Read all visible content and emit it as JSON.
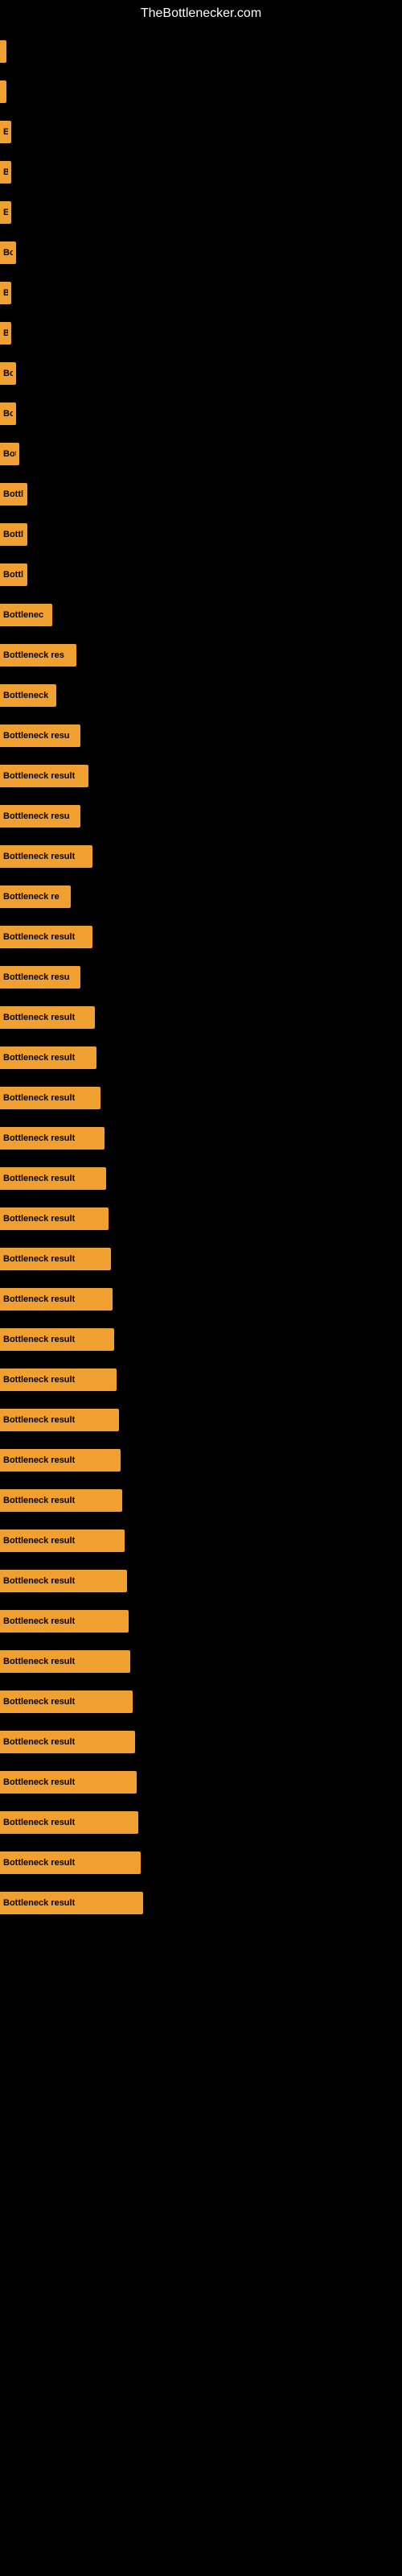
{
  "site": {
    "title": "TheBottlenecker.com"
  },
  "bars": [
    {
      "id": 1,
      "label": "",
      "width": 4
    },
    {
      "id": 2,
      "label": "",
      "width": 4
    },
    {
      "id": 3,
      "label": "E",
      "width": 14
    },
    {
      "id": 4,
      "label": "B",
      "width": 14
    },
    {
      "id": 5,
      "label": "E",
      "width": 14
    },
    {
      "id": 6,
      "label": "Bo",
      "width": 20
    },
    {
      "id": 7,
      "label": "B",
      "width": 14
    },
    {
      "id": 8,
      "label": "B",
      "width": 14
    },
    {
      "id": 9,
      "label": "Bo",
      "width": 20
    },
    {
      "id": 10,
      "label": "Bo",
      "width": 20
    },
    {
      "id": 11,
      "label": "Bot",
      "width": 24
    },
    {
      "id": 12,
      "label": "Bottl",
      "width": 34
    },
    {
      "id": 13,
      "label": "Bottl",
      "width": 34
    },
    {
      "id": 14,
      "label": "Bottl",
      "width": 34
    },
    {
      "id": 15,
      "label": "Bottlenec",
      "width": 65
    },
    {
      "id": 16,
      "label": "Bottleneck res",
      "width": 95
    },
    {
      "id": 17,
      "label": "Bottleneck",
      "width": 70
    },
    {
      "id": 18,
      "label": "Bottleneck resu",
      "width": 100
    },
    {
      "id": 19,
      "label": "Bottleneck result",
      "width": 110
    },
    {
      "id": 20,
      "label": "Bottleneck resu",
      "width": 100
    },
    {
      "id": 21,
      "label": "Bottleneck result",
      "width": 115
    },
    {
      "id": 22,
      "label": "Bottleneck re",
      "width": 88
    },
    {
      "id": 23,
      "label": "Bottleneck result",
      "width": 115
    },
    {
      "id": 24,
      "label": "Bottleneck resu",
      "width": 100
    },
    {
      "id": 25,
      "label": "Bottleneck result",
      "width": 118
    },
    {
      "id": 26,
      "label": "Bottleneck result",
      "width": 120
    },
    {
      "id": 27,
      "label": "Bottleneck result",
      "width": 125
    },
    {
      "id": 28,
      "label": "Bottleneck result",
      "width": 130
    },
    {
      "id": 29,
      "label": "Bottleneck result",
      "width": 132
    },
    {
      "id": 30,
      "label": "Bottleneck result",
      "width": 135
    },
    {
      "id": 31,
      "label": "Bottleneck result",
      "width": 138
    },
    {
      "id": 32,
      "label": "Bottleneck result",
      "width": 140
    },
    {
      "id": 33,
      "label": "Bottleneck result",
      "width": 142
    },
    {
      "id": 34,
      "label": "Bottleneck result",
      "width": 145
    },
    {
      "id": 35,
      "label": "Bottleneck result",
      "width": 148
    },
    {
      "id": 36,
      "label": "Bottleneck result",
      "width": 150
    },
    {
      "id": 37,
      "label": "Bottleneck result",
      "width": 152
    },
    {
      "id": 38,
      "label": "Bottleneck result",
      "width": 155
    },
    {
      "id": 39,
      "label": "Bottleneck result",
      "width": 158
    },
    {
      "id": 40,
      "label": "Bottleneck result",
      "width": 160
    },
    {
      "id": 41,
      "label": "Bottleneck result",
      "width": 162
    },
    {
      "id": 42,
      "label": "Bottleneck result",
      "width": 165
    },
    {
      "id": 43,
      "label": "Bottleneck result",
      "width": 168
    },
    {
      "id": 44,
      "label": "Bottleneck result",
      "width": 170
    },
    {
      "id": 45,
      "label": "Bottleneck result",
      "width": 172
    },
    {
      "id": 46,
      "label": "Bottleneck result",
      "width": 175
    },
    {
      "id": 47,
      "label": "Bottleneck result",
      "width": 178
    }
  ]
}
